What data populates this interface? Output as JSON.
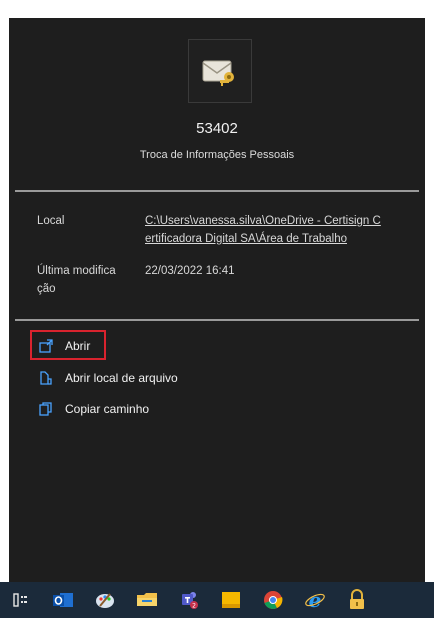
{
  "file": {
    "name": "53402",
    "type": "Troca de Informações Pessoais",
    "icon": "envelope-key-icon"
  },
  "properties": {
    "location_label": "Local",
    "location_value_line1": "C:\\Users\\vanessa.silva\\OneDrive - Certisign C",
    "location_value_line2": "ertificadora Digital SA\\Área de Trabalho",
    "modified_label_line1": "Última modifica",
    "modified_label_line2": "ção",
    "modified_value": "22/03/2022 16:41"
  },
  "actions": [
    {
      "label": "Abrir",
      "icon": "open-icon"
    },
    {
      "label": "Abrir local de arquivo",
      "icon": "file-location-icon"
    },
    {
      "label": "Copiar caminho",
      "icon": "copy-path-icon"
    }
  ],
  "colors": {
    "panel": "#1e1e1e",
    "highlight": "#d9232e",
    "accent": "#4aa3ff",
    "taskbar": "#1b2a3a"
  },
  "taskbar": {
    "items": [
      "task-view-icon",
      "outlook-icon",
      "paint-icon",
      "file-explorer-icon",
      "teams-icon",
      "sticky-notes-icon",
      "chrome-icon",
      "internet-explorer-icon",
      "lock-app-icon"
    ]
  }
}
